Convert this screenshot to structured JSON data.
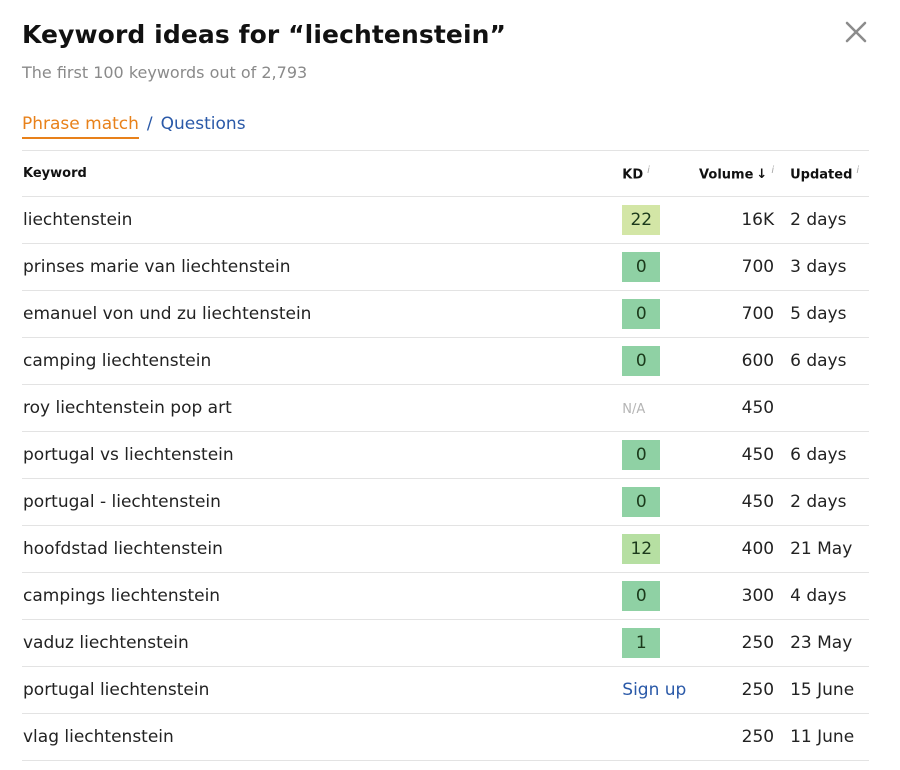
{
  "dialog": {
    "title": "Keyword ideas for “liechtenstein”",
    "subtitle": "The first 100 keywords out of 2,793"
  },
  "tabs": {
    "phrase_match": "Phrase match",
    "separator": "/",
    "questions": "Questions"
  },
  "table": {
    "headers": {
      "keyword": "Keyword",
      "kd": "KD",
      "volume": "Volume",
      "updated": "Updated"
    },
    "rows": [
      {
        "keyword": "liechtenstein",
        "kd": "22",
        "volume": "16K",
        "updated": "2 days"
      },
      {
        "keyword": "prinses marie van liechtenstein",
        "kd": "0",
        "volume": "700",
        "updated": "3 days"
      },
      {
        "keyword": "emanuel von und zu liechtenstein",
        "kd": "0",
        "volume": "700",
        "updated": "5 days"
      },
      {
        "keyword": "camping liechtenstein",
        "kd": "0",
        "volume": "600",
        "updated": "6 days"
      },
      {
        "keyword": "roy liechtenstein pop art",
        "kd": "N/A",
        "volume": "450",
        "updated": ""
      },
      {
        "keyword": "portugal vs liechtenstein",
        "kd": "0",
        "volume": "450",
        "updated": "6 days"
      },
      {
        "keyword": "portugal - liechtenstein",
        "kd": "0",
        "volume": "450",
        "updated": "2 days"
      },
      {
        "keyword": "hoofdstad liechtenstein",
        "kd": "12",
        "volume": "400",
        "updated": "21 May"
      },
      {
        "keyword": "campings liechtenstein",
        "kd": "0",
        "volume": "300",
        "updated": "4 days"
      },
      {
        "keyword": "vaduz liechtenstein",
        "kd": "1",
        "volume": "250",
        "updated": "23 May"
      },
      {
        "keyword": "portugal liechtenstein",
        "kd": "Sign up",
        "volume": "250",
        "updated": "15 June"
      },
      {
        "keyword": "vlag liechtenstein",
        "kd": "",
        "volume": "250",
        "updated": "11 June"
      }
    ]
  },
  "colors": {
    "accent_orange": "#e8811a",
    "link_blue": "#2a59a8",
    "kd_easy": "#8fd1a4",
    "kd_light": "#b6dfa2",
    "kd_mid": "#d3e6a6"
  }
}
